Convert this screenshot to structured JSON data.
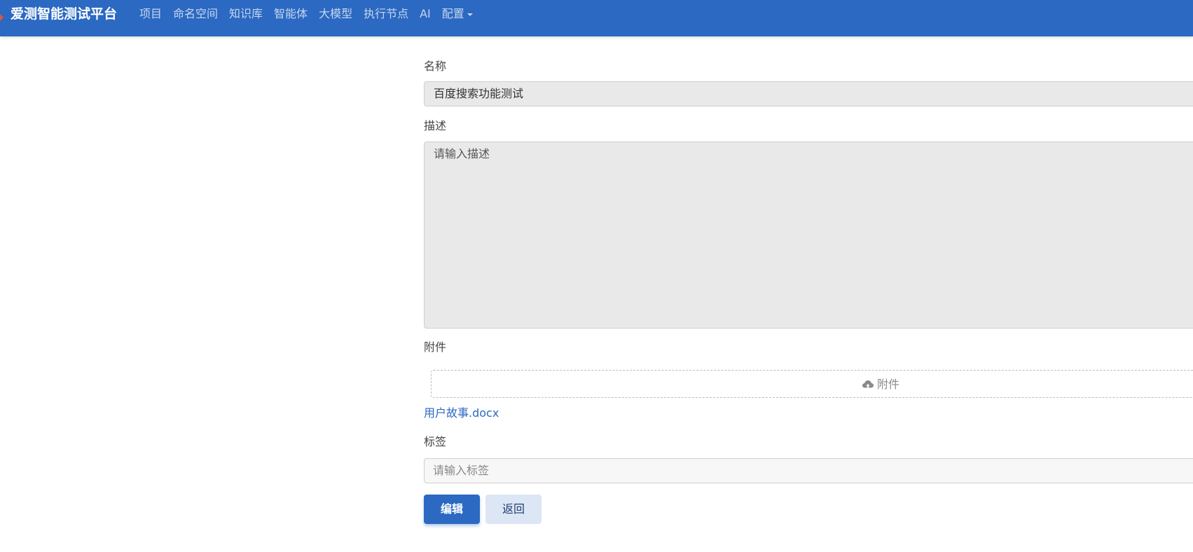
{
  "brand": "爱测智能测试平台",
  "colors": {
    "navbar": "#2b69c2",
    "link": "#2b69c2",
    "input_disabled": "#e9e9e9"
  },
  "nav": {
    "items": [
      {
        "label": "项目"
      },
      {
        "label": "命名空间"
      },
      {
        "label": "知识库"
      },
      {
        "label": "智能体"
      },
      {
        "label": "大模型"
      },
      {
        "label": "执行节点"
      },
      {
        "label": "AI"
      },
      {
        "label": "配置",
        "dropdown": true
      }
    ]
  },
  "form": {
    "name": {
      "label": "名称",
      "value": "百度搜索功能测试"
    },
    "description": {
      "label": "描述",
      "placeholder": "请输入描述"
    },
    "attachment": {
      "label": "附件",
      "upload_label": "附件",
      "upload_icon": "cloud-upload-icon",
      "file_name": "用户故事.docx"
    },
    "tags": {
      "label": "标签",
      "placeholder": "请输入标签"
    },
    "buttons": {
      "edit_label": "编辑",
      "back_label": "返回"
    }
  }
}
